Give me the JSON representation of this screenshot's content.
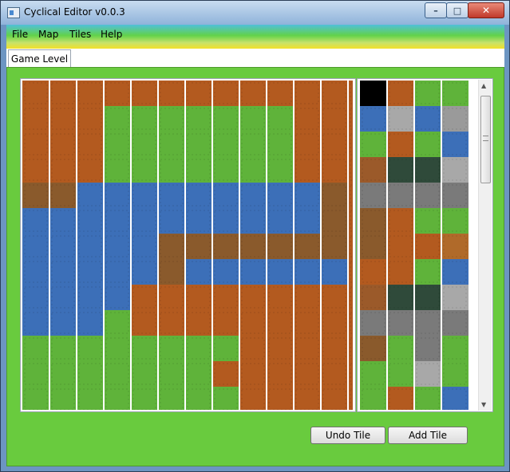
{
  "window": {
    "title": "Cyclical Editor v0.0.3"
  },
  "window_controls": {
    "minimize": "–",
    "maximize": "□",
    "close": "✕"
  },
  "menu": {
    "items": [
      "File",
      "Map",
      "Tiles",
      "Help"
    ]
  },
  "tabs": [
    {
      "label": "Game Level",
      "selected": true
    }
  ],
  "buttons": {
    "undo": "Undo Tile",
    "add": "Add Tile"
  },
  "colors": {
    "grass": "#5fb33a",
    "dirt": "#b35a1f",
    "water": "#3c6fb8",
    "bridge": "#8a5a2c",
    "background": "#69cb3e"
  },
  "map": {
    "rows": [
      "ddddddddddddd",
      "dddgggggggddd",
      "dddgggggggddd",
      "dddgggggggddd",
      "bbwwwwwwwwwbd",
      "wwwwwwwwwwwbd",
      "wwwwwbbbbbbbd",
      "wwwwwbwwwwwwd",
      "wwwwddddddddd",
      "wwwgdddddddd d",
      "ggggggggdddd d",
      "gggggggddddd d",
      "ggggggggdddd d"
    ]
  },
  "palette": {
    "rows": [
      "kdgg",
      "wswl",
      "gdgw",
      "hmms",
      "rrrr",
      "bdgg",
      "bddc",
      "ddgw",
      "hmms",
      "rrrr",
      "bgrg",
      "ggsg",
      "gdgw"
    ]
  }
}
